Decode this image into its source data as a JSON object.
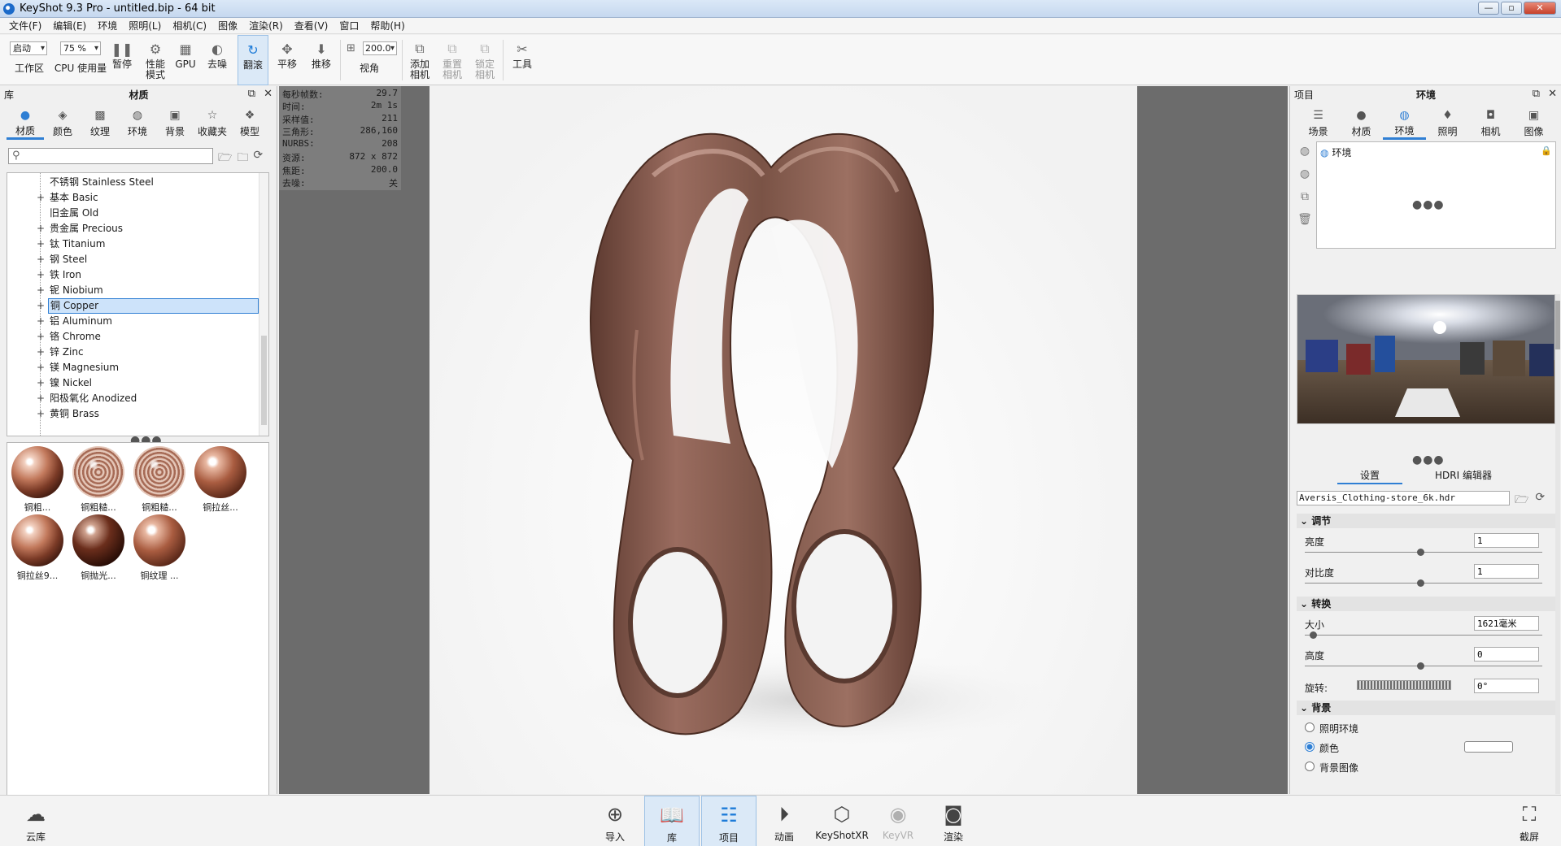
{
  "window": {
    "title": "KeyShot 9.3 Pro  - untitled.bip  - 64 bit",
    "min": "—",
    "max": "▫",
    "close": "✕"
  },
  "menu": [
    "文件(F)",
    "编辑(E)",
    "环境",
    "照明(L)",
    "相机(C)",
    "图像",
    "渲染(R)",
    "查看(V)",
    "窗口",
    "帮助(H)"
  ],
  "toolbar": {
    "workspace_select": "启动",
    "workspace_label": "工作区",
    "cpu_select": "75 %",
    "cpu_label": "CPU 使用量",
    "pause": "暂停",
    "perf_mode": "性能\n模式",
    "gpu": "GPU",
    "denoise": "去噪",
    "tumble": "翻滚",
    "pan": "平移",
    "dolly": "推移",
    "fov_value": "200.0",
    "fov_label": "视角",
    "add_camera": "添加\n相机",
    "reset_camera": "重置\n相机",
    "lock_camera": "锁定\n相机",
    "tools": "工具"
  },
  "library": {
    "header_left": "库",
    "header_title": "材质",
    "tabs": [
      "材质",
      "颜色",
      "纹理",
      "环境",
      "背景",
      "收藏夹",
      "模型"
    ],
    "search_placeholder": "",
    "tree": [
      {
        "name": "不锈钢 Stainless Steel",
        "expand": ""
      },
      {
        "name": "基本 Basic",
        "expand": "+"
      },
      {
        "name": "旧金属 Old",
        "expand": ""
      },
      {
        "name": "贵金属 Precious",
        "expand": "+"
      },
      {
        "name": "钛 Titanium",
        "expand": "+"
      },
      {
        "name": "钢 Steel",
        "expand": "+"
      },
      {
        "name": "铁 Iron",
        "expand": "+"
      },
      {
        "name": "铌 Niobium",
        "expand": "+"
      },
      {
        "name": "铜 Copper",
        "expand": "+"
      },
      {
        "name": "铝 Aluminum",
        "expand": "+"
      },
      {
        "name": "铬 Chrome",
        "expand": "+"
      },
      {
        "name": "锌 Zinc",
        "expand": "+"
      },
      {
        "name": "镁 Magnesium",
        "expand": "+"
      },
      {
        "name": "镍 Nickel",
        "expand": "+"
      },
      {
        "name": "阳极氧化 Anodized",
        "expand": "+"
      },
      {
        "name": "黄铜 Brass",
        "expand": "+"
      }
    ],
    "selected_index": 8,
    "thumbnails": [
      "铜粗...",
      "铜粗糙...",
      "铜粗糙...",
      "铜拉丝...",
      "铜拉丝9...",
      "铜抛光...",
      "铜纹理 ..."
    ]
  },
  "stats": [
    {
      "k": "每秒帧数:",
      "v": "29.7"
    },
    {
      "k": "时间:",
      "v": "2m 1s"
    },
    {
      "k": "采样值:",
      "v": "211"
    },
    {
      "k": "三角形:",
      "v": "286,160"
    },
    {
      "k": "NURBS:",
      "v": "208"
    },
    {
      "k": "资源:",
      "v": "872 x 872"
    },
    {
      "k": "焦距:",
      "v": "200.0"
    },
    {
      "k": "去噪:",
      "v": "关"
    }
  ],
  "project": {
    "header_left": "项目",
    "header_title": "环境",
    "tabs": [
      "场景",
      "材质",
      "环境",
      "照明",
      "相机",
      "图像"
    ],
    "env_item": "环境",
    "subtabs": [
      "设置",
      "HDRI 编辑器"
    ],
    "hdri_file": "Aversis_Clothing-store_6k.hdr",
    "sections": {
      "adjust": "调节",
      "transform": "转换",
      "background": "背景"
    },
    "props": {
      "brightness_label": "亮度",
      "brightness_value": "1",
      "contrast_label": "对比度",
      "contrast_value": "1",
      "size_label": "大小",
      "size_value": "1621毫米",
      "height_label": "高度",
      "height_value": "0",
      "rotation_label": "旋转:",
      "rotation_value": "0°"
    },
    "background_options": [
      "照明环境",
      "颜色",
      "背景图像"
    ],
    "background_selected": 1
  },
  "dock": {
    "cloud": "云库",
    "import": "导入",
    "library": "库",
    "project": "项目",
    "animation": "动画",
    "keyshotxr": "KeyShotXR",
    "keyvr": "KeyVR",
    "render": "渲染",
    "screenshot": "截屏"
  },
  "colors": {
    "accent": "#2f7fd4",
    "viewport_bg": "#6c6c6c",
    "copper": "#8a5a4c"
  }
}
